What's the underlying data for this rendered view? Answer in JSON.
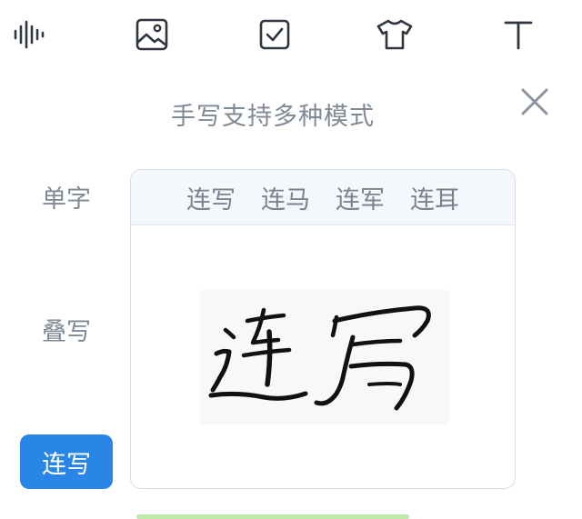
{
  "toolbar": {
    "items": [
      {
        "name": "voice",
        "icon": "waveform-icon"
      },
      {
        "name": "image",
        "icon": "image-icon"
      },
      {
        "name": "checklist",
        "icon": "checkbox-icon"
      },
      {
        "name": "skin",
        "icon": "tshirt-icon"
      },
      {
        "name": "text",
        "icon": "text-t-icon"
      }
    ]
  },
  "panel": {
    "title": "手写支持多种模式",
    "close_icon": "close-icon"
  },
  "modes": {
    "items": [
      {
        "label": "单字",
        "active": false
      },
      {
        "label": "叠写",
        "active": false
      },
      {
        "label": "连写",
        "active": true
      }
    ]
  },
  "demo": {
    "candidates": [
      "连写",
      "连马",
      "连军",
      "连耳"
    ],
    "handwriting_text": "连写"
  },
  "colors": {
    "accent": "#2a86e6",
    "muted_text": "#7f8894",
    "icon": "#2f3640"
  }
}
